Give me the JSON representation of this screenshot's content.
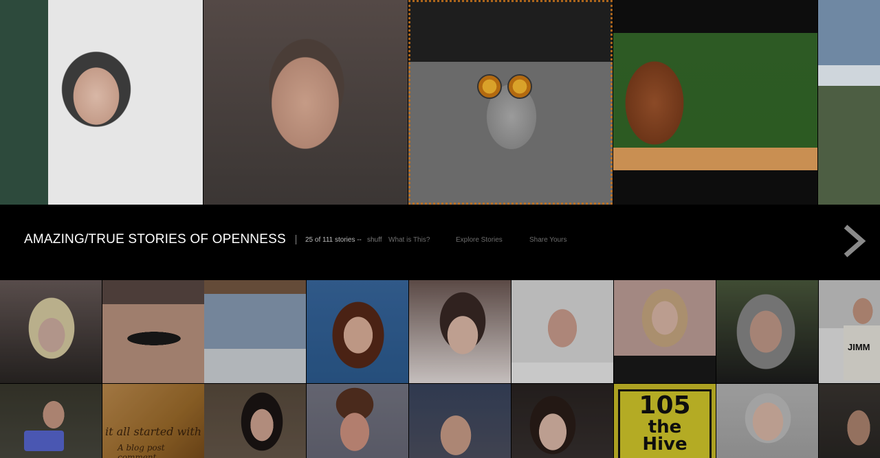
{
  "header": {
    "title": "AMAZING/TRUE STORIES OF OPENNESS",
    "story_count": "25 of 111 stories --",
    "shuffle": "shuff",
    "nav": [
      "What is This?",
      "Explore Stories",
      "Share Yours"
    ],
    "next_icon": "chevron-right-icon"
  },
  "featured_tiles": [
    "video-portrait-1",
    "video-portrait-2",
    "glasses-portrait",
    "bigfoot-statue-photo",
    "mountain-photo"
  ],
  "grid_row1": [
    "blonde-woman",
    "wing-tattoo",
    "snowy-tree",
    "smiling-woman",
    "young-woman",
    "bald-man",
    "woman-glasses",
    "gray-haired-man",
    "man-with-book"
  ],
  "grid_row2": [
    "woman-with-camera",
    "parchment-text",
    "young-woman-2",
    "young-man",
    "man-in-cap",
    "dark-haired-woman",
    "hive-sign",
    "bearded-man",
    "long-haired-man"
  ],
  "tile_text": {
    "book": "JIMM",
    "parchment_line1": "it all started with",
    "parchment_line2": "A blog post comment",
    "sign_number": "105",
    "sign_the": "the",
    "sign_hive": "Hive"
  },
  "colors": {
    "background": "#000000",
    "title": "#ffffff",
    "nav": "#6e6e6e"
  }
}
